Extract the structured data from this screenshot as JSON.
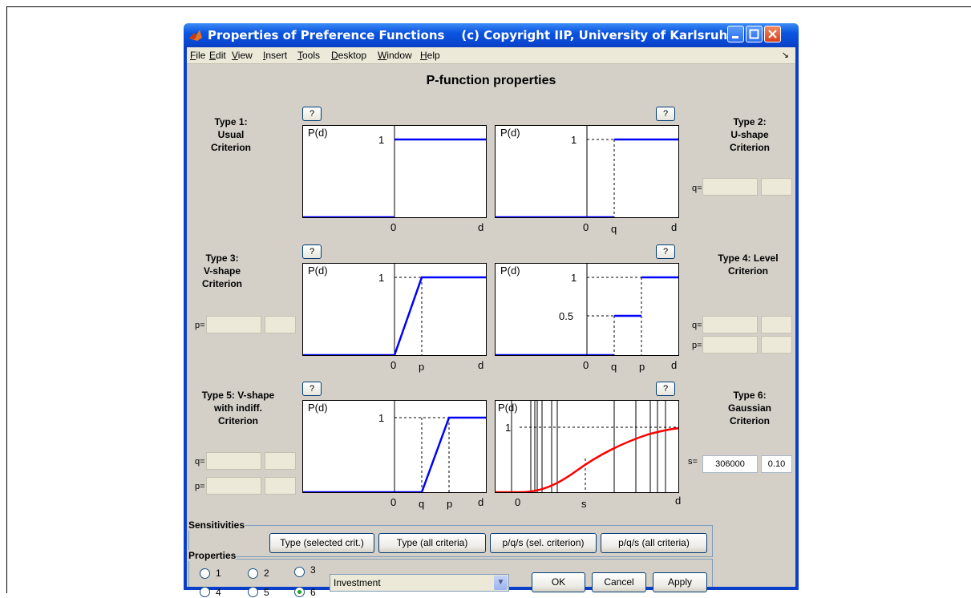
{
  "window": {
    "title": "Properties of Preference Functions    (c) Copyright IIP, University of Karlsruhe",
    "app_icon": "matlab-logo-icon"
  },
  "menu": [
    "File",
    "Edit",
    "View",
    "Insert",
    "Tools",
    "Desktop",
    "Window",
    "Help"
  ],
  "heading": "P-function properties",
  "help_label": "?",
  "types": {
    "t1": "Type 1:\nUsual\nCriterion",
    "t2": "Type 2:\nU-shape\nCriterion",
    "t3": "Type 3:\nV-shape\nCriterion",
    "t4": "Type 4: Level\nCriterion",
    "t5": "Type 5: V-shape\nwith indiff.\nCriterion",
    "t6": "Type 6:\nGaussian\nCriterion"
  },
  "plot_text": {
    "pd": "P(d)",
    "one": "1",
    "half": "0.5",
    "zero": "0",
    "d": "d",
    "q": "q",
    "p": "p",
    "s": "s"
  },
  "params": {
    "q_label": "q=",
    "p_label": "p=",
    "s_label": "s=",
    "s_value": "306000",
    "s_value2": "0.10"
  },
  "sensitivities": {
    "title": "Sensitivities",
    "buttons": [
      "Type (selected crit.)",
      "Type (all criteria)",
      "p/q/s (sel. criterion)",
      "p/q/s (all criteria)"
    ]
  },
  "properties": {
    "title": "Properties",
    "radios": [
      "1",
      "2",
      "3",
      "4",
      "5",
      "6"
    ],
    "selected": "6",
    "criterion": "Investment",
    "ok": "OK",
    "cancel": "Cancel",
    "apply": "Apply"
  },
  "colors": {
    "blue_line": "#0000ff",
    "red_line": "#ff0000",
    "title_blue": "#0a46cf"
  }
}
